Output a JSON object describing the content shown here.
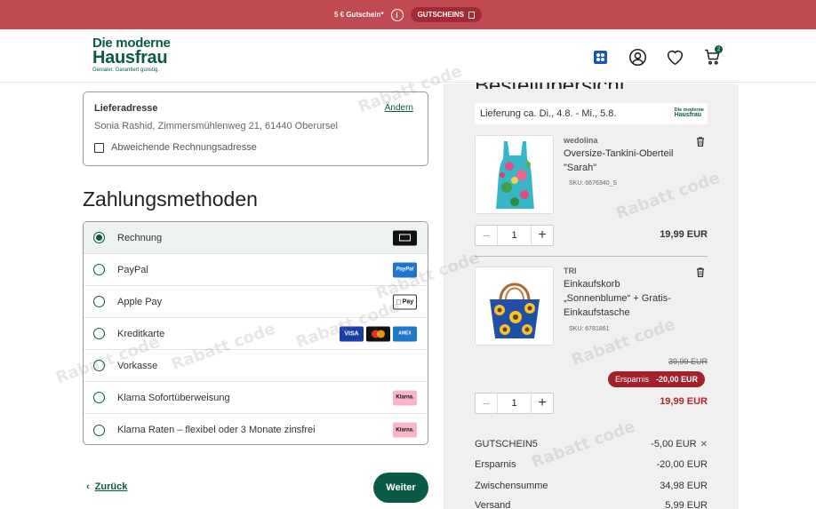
{
  "promo": {
    "text": "5 € Gutschein*",
    "voucher_button": "GUTSCHEINS"
  },
  "header": {
    "logo_line1": "Die moderne",
    "logo_line2": "Hausfrau",
    "logo_tagline": "Genialer. Garantiert günstig.",
    "cart_count": "2"
  },
  "address": {
    "title": "Lieferadresse",
    "change_label": "Ändern",
    "value": "Sonia Rashid, Zimmersmühlenweg 21, 61440 Oberursel",
    "alt_billing_label": "Abweichende Rechnungsadresse"
  },
  "payment": {
    "heading": "Zahlungsmethoden",
    "methods": [
      {
        "label": "Rechnung",
        "selected": true
      },
      {
        "label": "PayPal",
        "selected": false
      },
      {
        "label": "Apple Pay",
        "selected": false
      },
      {
        "label": "Kreditkarte",
        "selected": false
      },
      {
        "label": "Vorkasse",
        "selected": false
      },
      {
        "label": "Klarna Sofortüberweisung",
        "selected": false
      },
      {
        "label": "Klarna Raten – flexibel oder 3 Monate zinsfrei",
        "selected": false
      }
    ],
    "badges": {
      "paypal": "PayPal",
      "applepay": "Pay",
      "visa": "VISA",
      "amex": "AMEX",
      "klarna": "Klarna."
    }
  },
  "nav": {
    "back_label": "Zurück",
    "next_label": "Weiter"
  },
  "summary": {
    "heading": "Bestellübersicht",
    "delivery": "Lieferung ca. Di., 4.8. - Mi., 5.8.",
    "delivery_logo_l1": "Die moderne",
    "delivery_logo_l2": "Hausfrau",
    "items": [
      {
        "brand": "wedolina",
        "name": "Oversize-Tankini-Oberteil \"Sarah\"",
        "sku": "SKU: 6676340_S",
        "qty": "1",
        "price": "19,99 EUR"
      },
      {
        "brand": "TRI",
        "name": "Einkaufskorb „Sonnenblume“ + Gratis-Einkaufstasche",
        "sku": "SKU: 6781861",
        "qty": "1",
        "old_price": "39,99 EUR",
        "savings_label": "Ersparnis",
        "savings_value": "-20,00 EUR",
        "price": "19,99 EUR"
      }
    ],
    "totals": [
      {
        "label": "GUTSCHEIN5",
        "value": "-5,00 EUR"
      },
      {
        "label": "Ersparnis",
        "value": "-20,00 EUR"
      },
      {
        "label": "Zwischensumme",
        "value": "34,98 EUR"
      },
      {
        "label": "Versand",
        "value": "5,99 EUR"
      }
    ]
  },
  "watermark": "Rabatt code"
}
